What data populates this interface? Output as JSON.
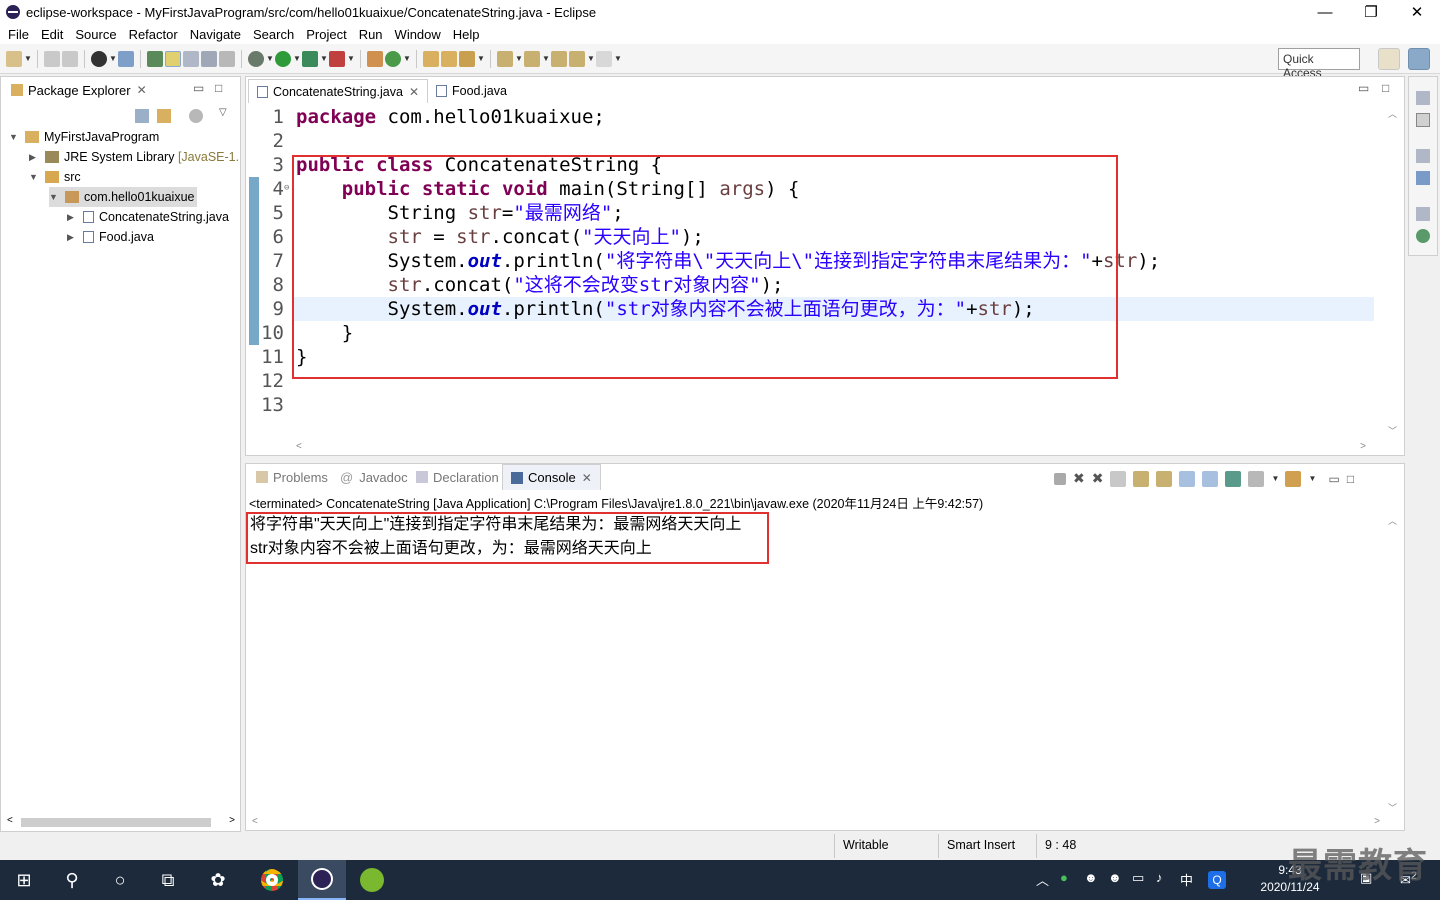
{
  "window": {
    "title": "eclipse-workspace - MyFirstJavaProgram/src/com/hello01kuaixue/ConcatenateString.java - Eclipse",
    "minimize": "—",
    "maximize": "❐",
    "close": "✕"
  },
  "menu": [
    "File",
    "Edit",
    "Source",
    "Refactor",
    "Navigate",
    "Search",
    "Project",
    "Run",
    "Window",
    "Help"
  ],
  "toolbar": {
    "quick_access": "Quick Access"
  },
  "package_explorer": {
    "title": "Package Explorer",
    "project": "MyFirstJavaProgram",
    "jre": "JRE System Library",
    "jre_version": "[JavaSE-1.",
    "src": "src",
    "package": "com.hello01kuaixue",
    "files": [
      "ConcatenateString.java",
      "Food.java"
    ]
  },
  "editor": {
    "tabs": [
      "ConcatenateString.java",
      "Food.java"
    ],
    "line_numbers": [
      "1",
      "2",
      "3",
      "4",
      "5",
      "6",
      "7",
      "8",
      "9",
      "10",
      "11",
      "12",
      "13"
    ],
    "lines": {
      "l1_kw": "package",
      "l1_rest": " com.hello01kuaixue;",
      "l3_kw1": "public",
      "l3_kw2": "class",
      "l3_rest": " ConcatenateString {",
      "l4_indent": "    ",
      "l4_kw1": "public",
      "l4_kw2": "static",
      "l4_kw3": "void",
      "l4_rest": " main(String[] ",
      "l4_var": "args",
      "l4_end": ") {",
      "l5_a": "        String ",
      "l5_var": "str",
      "l5_eq": "=",
      "l5_str": "\"最需网络\"",
      "l5_end": ";",
      "l6_a": "        ",
      "l6_var1": "str",
      "l6_eq": " = ",
      "l6_var2": "str",
      "l6_mid": ".concat(",
      "l6_str": "\"天天向上\"",
      "l6_end": ");",
      "l7_a": "        System.",
      "l7_fld": "out",
      "l7_mid": ".println(",
      "l7_str": "\"将字符串\\\"天天向上\\\"连接到指定字符串末尾结果为：\"",
      "l7_plus": "+",
      "l7_var": "str",
      "l7_end": ");",
      "l8_a": "        ",
      "l8_var": "str",
      "l8_mid": ".concat(",
      "l8_str": "\"这将不会改变str对象内容\"",
      "l8_end": ");",
      "l9_a": "        System.",
      "l9_fld": "out",
      "l9_mid": ".println(",
      "l9_str": "\"str对象内容不会被上面语句更改，为：\"",
      "l9_plus": "+",
      "l9_var": "str",
      "l9_end": ");",
      "l10": "    }",
      "l11": "}"
    }
  },
  "console_view": {
    "tabs": [
      "Problems",
      "Javadoc",
      "Declaration",
      "Console"
    ],
    "info": "<terminated> ConcatenateString [Java Application] C:\\Program Files\\Java\\jre1.8.0_221\\bin\\javaw.exe (2020年11月24日 上午9:42:57)",
    "output": [
      "将字符串\"天天向上\"连接到指定字符串末尾结果为：最需网络天天向上",
      "str对象内容不会被上面语句更改，为：最需网络天天向上"
    ]
  },
  "status": {
    "writable": "Writable",
    "insert_mode": "Smart Insert",
    "position": "9 : 48"
  },
  "taskbar": {
    "ime": "中",
    "time": "9:43",
    "date": "2020/11/24",
    "notifications": "2"
  },
  "watermark": "最需教育",
  "colors": {
    "keyword": "#7f0055",
    "string": "#2a00ff",
    "field": "#0000c0",
    "highlight_box": "#e03030",
    "taskbar": "#1c2a3c"
  }
}
